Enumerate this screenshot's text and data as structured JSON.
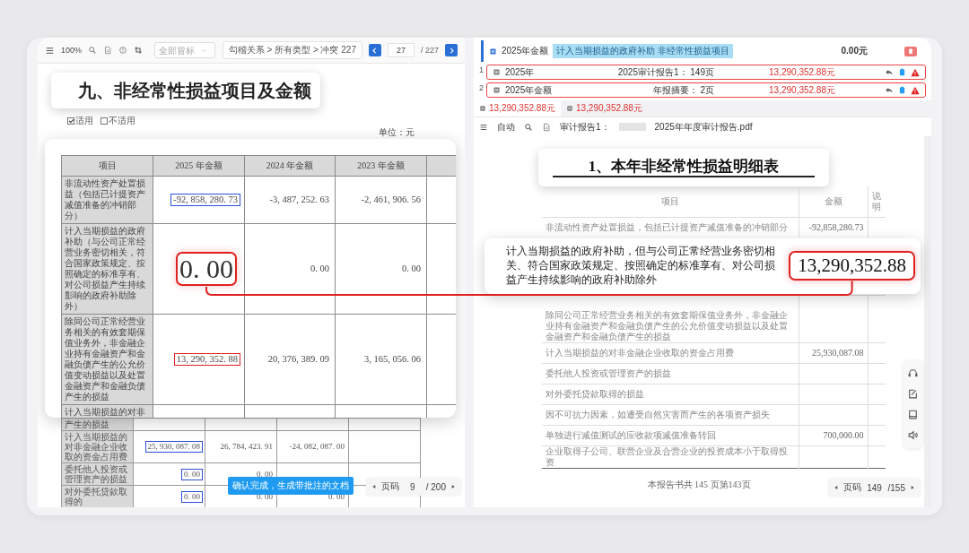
{
  "left_viewer": {
    "toolbar": {
      "zoom": "100%",
      "filter": {
        "placeholder": "全部冒标"
      },
      "breadcrumb": "勾稽关系 > 所有类型 > 冲突 227",
      "page": "27",
      "total": "/ 227"
    },
    "page": {
      "heading": "九、非经常性损益项目及金额",
      "options": [
        {
          "label": "适用",
          "checked": true
        },
        {
          "label": "不适用",
          "checked": false
        }
      ],
      "unit": "单位：元",
      "zoom_table": {
        "columns": [
          "项目",
          "2025 年金额",
          "2024 年金额",
          "2023 年金额"
        ],
        "rows": [
          {
            "item": "非流动性资产处置损益（包括已计提资产减值准备的冲销部分）",
            "values": [
              {
                "kind": "boxed",
                "text": "-92, 858, 280. 73",
                "color": "#2b4fd8"
              },
              {
                "kind": "plain",
                "text": "-3, 487, 252. 63"
              },
              {
                "kind": "plain",
                "text": "-2, 461, 906. 56"
              }
            ]
          },
          {
            "item": "计入当期损益的政府补助（与公司正常经营业务密切相关，符合国家政策规定、按照确定的标准享有、对公司损益产生持续影响的政府补助除外）",
            "values": [
              {
                "kind": "callout",
                "text": "0. 00",
                "color": "#e02020"
              },
              {
                "kind": "plain",
                "text": "0. 00"
              },
              {
                "kind": "plain",
                "text": "0. 00"
              }
            ]
          },
          {
            "item": "除同公司正常经营业务相关的有效套期保值业务外，非金融企业持有金融资产和金融负债产生的公允价值变动损益以及处置金融资产和金融负债产生的损益",
            "values": [
              {
                "kind": "boxed",
                "text": "13, 290, 352. 88",
                "color": "#e02020"
              },
              {
                "kind": "plain",
                "text": "20, 376, 389. 09"
              },
              {
                "kind": "plain",
                "text": "3, 165, 056. 06"
              }
            ]
          },
          {
            "item": "计入当期损益的对非",
            "values": []
          }
        ]
      },
      "table": {
        "rows": [
          {
            "item": "产生的损益",
            "values": []
          },
          {
            "item": "计入当期损益的对非金融企业收取的资金占用费",
            "values": [
              {
                "kind": "boxed",
                "text": "25, 930, 087. 08",
                "color": "#2b4fd8"
              },
              {
                "kind": "plain",
                "text": "26, 784, 423. 91"
              },
              {
                "kind": "plain",
                "text": "-24, 082, 087. 00"
              }
            ]
          },
          {
            "item": "委托他人投资或管理资产的损益",
            "values": [
              {
                "kind": "boxed",
                "text": "0. 00",
                "color": "#2b4fd8"
              },
              {
                "kind": "plain",
                "text": "0. 00"
              }
            ]
          },
          {
            "item": "对外委托贷款取得的",
            "values": [
              {
                "kind": "boxed",
                "text": "0. 00",
                "color": "#2b4fd8"
              },
              {
                "kind": "plain",
                "text": "0. 00"
              },
              {
                "kind": "plain",
                "text": "0. 00"
              }
            ]
          }
        ]
      }
    },
    "confirm_button": "确认完成，生成带批注的文档",
    "pager": {
      "label": "页码",
      "page": "9",
      "total": "/ 200"
    }
  },
  "right_viewer": {
    "match_header": {
      "label": "2025年金额",
      "tag": "计入当期损益的政府补助 非经常性损益项目",
      "amount": "0.00元"
    },
    "matches": [
      {
        "index": "1",
        "label": "2025年",
        "source": "2025审计报告1：  149页",
        "amount": "13,290,352.88元",
        "conflict": true
      },
      {
        "index": "2",
        "label": "2025年金额",
        "source": "年报摘要：  2页",
        "amount": "13,290,352.88元",
        "conflict": true
      }
    ],
    "tabs": [
      {
        "label": "13,290,352.88元",
        "selected": true
      },
      {
        "label": "13,290,352.88元",
        "selected": false
      }
    ],
    "doc_toolbar": {
      "mode": "自动",
      "file_label": "审计报告1：",
      "file_name": "2025年年度审计报告.pdf"
    },
    "page": {
      "heading": "1、本年非经常性损益明细表",
      "columns": [
        "项目",
        "金额",
        "说明"
      ],
      "rows": [
        {
          "kind": "row",
          "item": "非流动性资产处置损益，包括已计提资产减值准备的冲销部分",
          "amount": "-92,858,280.73"
        },
        {
          "kind": "callout",
          "item": "计入当期损益的政府补助，但与公司正常经营业务密切相关、符合国家政策规定、按照确定的标准享有、对公司损益产生持续影响的政府补助除外",
          "amount": "13,290,352.88"
        },
        {
          "kind": "row",
          "item": "除同公司正常经营业务相关的有效套期保值业务外，非金融企业持有金融资产和金融负债产生的公允价值变动损益以及处置金融资产和金融负债产生的损益"
        },
        {
          "kind": "row",
          "item": "计入当期损益的对非金融企业收取的资金占用费",
          "amount": "25,930,087.08"
        },
        {
          "kind": "row",
          "item": "委托他人投资或管理资产的损益"
        },
        {
          "kind": "row",
          "item": "对外委托贷款取得的损益"
        },
        {
          "kind": "row",
          "item": "因不可抗力因素，如遭受自然灾害而产生的各项资产损失"
        },
        {
          "kind": "row",
          "item": "单独进行减值测试的应收款项减值准备转回",
          "amount": "700,000.00"
        },
        {
          "kind": "row",
          "item": "企业取得子公司、联营企业及合营企业的投资成本小于取得投资"
        }
      ],
      "footer": "本报告书共 145 页第143页"
    },
    "pager": {
      "label": "页码",
      "page": "149",
      "total": "/155"
    }
  }
}
